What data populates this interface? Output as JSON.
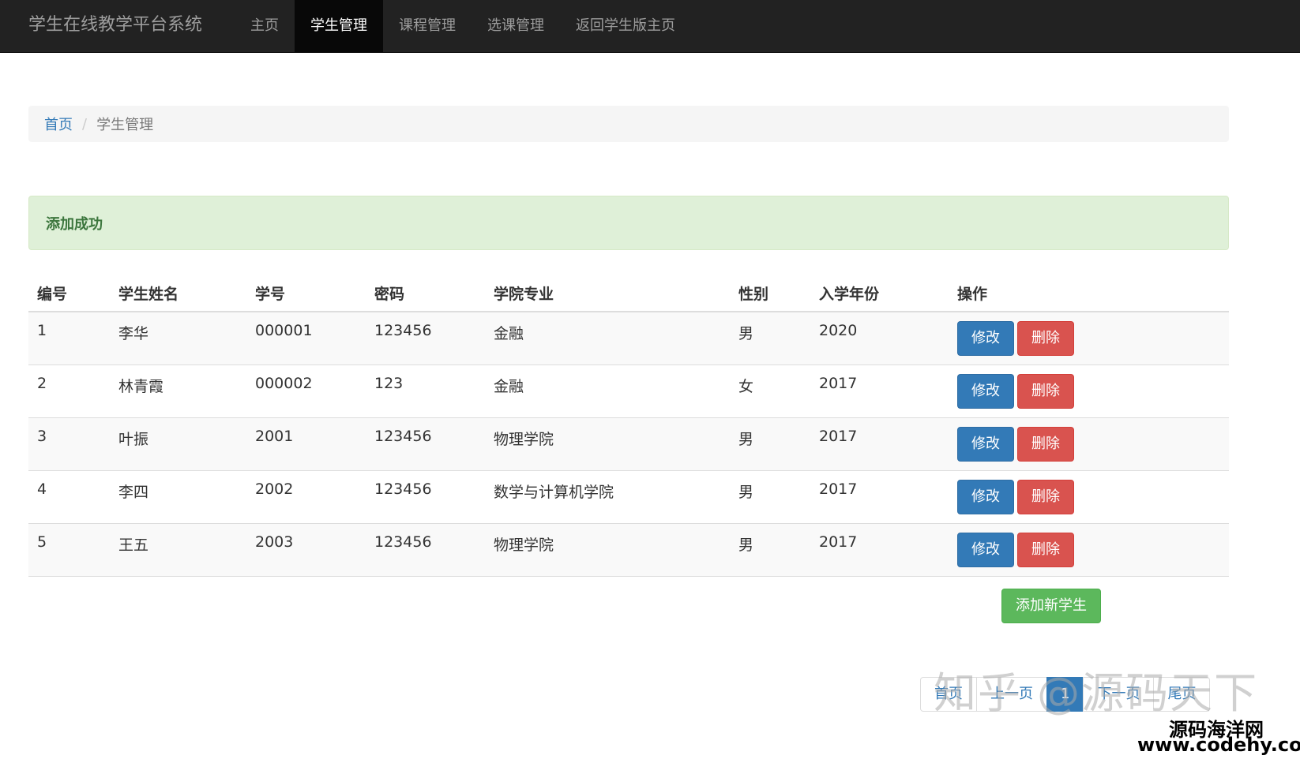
{
  "navbar": {
    "brand": "学生在线教学平台系统",
    "items": [
      {
        "label": "主页",
        "active": false
      },
      {
        "label": "学生管理",
        "active": true
      },
      {
        "label": "课程管理",
        "active": false
      },
      {
        "label": "选课管理",
        "active": false
      },
      {
        "label": "返回学生版主页",
        "active": false
      }
    ]
  },
  "breadcrumb": {
    "home": "首页",
    "separator": "/",
    "current": "学生管理"
  },
  "alert": {
    "message": "添加成功"
  },
  "table": {
    "headers": [
      "编号",
      "学生姓名",
      "学号",
      "密码",
      "学院专业",
      "性别",
      "入学年份",
      "操作"
    ],
    "rows": [
      {
        "id": "1",
        "name": "李华",
        "sid": "000001",
        "password": "123456",
        "major": "金融",
        "gender": "男",
        "year": "2020"
      },
      {
        "id": "2",
        "name": "林青霞",
        "sid": "000002",
        "password": "123",
        "major": "金融",
        "gender": "女",
        "year": "2017"
      },
      {
        "id": "3",
        "name": "叶振",
        "sid": "2001",
        "password": "123456",
        "major": "物理学院",
        "gender": "男",
        "year": "2017"
      },
      {
        "id": "4",
        "name": "李四",
        "sid": "2002",
        "password": "123456",
        "major": "数学与计算机学院",
        "gender": "男",
        "year": "2017"
      },
      {
        "id": "5",
        "name": "王五",
        "sid": "2003",
        "password": "123456",
        "major": "物理学院",
        "gender": "男",
        "year": "2017"
      }
    ],
    "edit_label": "修改",
    "delete_label": "删除"
  },
  "add_button": "添加新学生",
  "pagination": [
    "首页",
    "上一页",
    "1",
    "下一页",
    "尾页"
  ],
  "watermarks": {
    "zhihu": "知乎 @源码天下",
    "site_name": "源码海洋网",
    "site_url": "www.codehy.com"
  }
}
